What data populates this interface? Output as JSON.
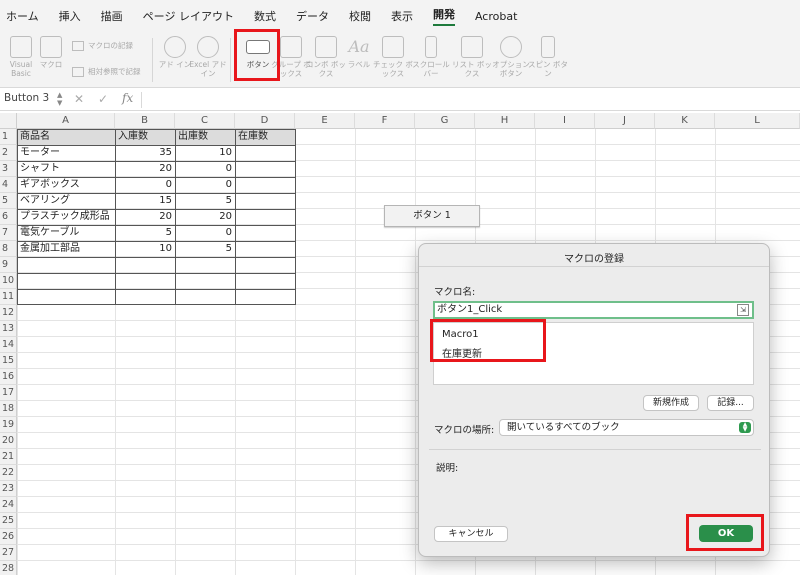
{
  "tabs": [
    "ホーム",
    "挿入",
    "描画",
    "ページ レイアウト",
    "数式",
    "データ",
    "校閲",
    "表示",
    "開発",
    "Acrobat"
  ],
  "active_tab": "開発",
  "ribbon": {
    "visual_basic": "Visual Basic",
    "macro": "マクロ",
    "record_macro": "マクロの記録",
    "relative_ref": "相対参照で記録",
    "addins": "アド イン",
    "excel_addins": "Excel アドイン",
    "button": "ボタン",
    "groupbox": "グループ ボックス",
    "combobox": "コンボ ボックス",
    "label": "ラベル",
    "checkbox": "チェック ボックス",
    "scrollbar": "スクロール バー",
    "listbox": "リスト ボックス",
    "option_button": "オプション ボタン",
    "spin_button": "スピン ボタン",
    "label_icon_text": "Aa"
  },
  "formula_bar": {
    "name_box": "Button 3",
    "fx": "fx",
    "cancel": "✕",
    "enter": "✓"
  },
  "columns": [
    "A",
    "B",
    "C",
    "D",
    "E",
    "F",
    "G",
    "H",
    "I",
    "J",
    "K",
    "L"
  ],
  "rows": [
    "1",
    "2",
    "3",
    "4",
    "5",
    "6",
    "7",
    "8",
    "9",
    "10",
    "11",
    "12",
    "13",
    "14",
    "15",
    "16",
    "17",
    "18",
    "19",
    "20",
    "21",
    "22",
    "23",
    "24",
    "25",
    "26",
    "27",
    "28"
  ],
  "table": {
    "headers": [
      "商品名",
      "入庫数",
      "出庫数",
      "在庫数"
    ],
    "rows": [
      [
        "モーター",
        "35",
        "10"
      ],
      [
        "シャフト",
        "20",
        "0"
      ],
      [
        "ギアボックス",
        "0",
        "0"
      ],
      [
        "ベアリング",
        "15",
        "5"
      ],
      [
        "プラスチック成形品",
        "20",
        "20"
      ],
      [
        "電気ケーブル",
        "5",
        "0"
      ],
      [
        "金属加工部品",
        "10",
        "5"
      ]
    ]
  },
  "sheet_button": "ボタン 1",
  "dialog": {
    "title": "マクロの登録",
    "macro_name_label": "マクロ名:",
    "macro_name_value": "ボタン1_Click",
    "macros": [
      "Macro1",
      "在庫更新"
    ],
    "new_button": "新規作成",
    "record_button": "記録...",
    "location_label": "マクロの場所:",
    "location_value": "開いているすべてのブック",
    "description_label": "説明:",
    "cancel_button": "キャンセル",
    "ok_button": "OK"
  },
  "colors": {
    "highlight": "#e8161b",
    "ok_green": "#2a8f4a",
    "tab_underline": "#1e7a3c"
  }
}
